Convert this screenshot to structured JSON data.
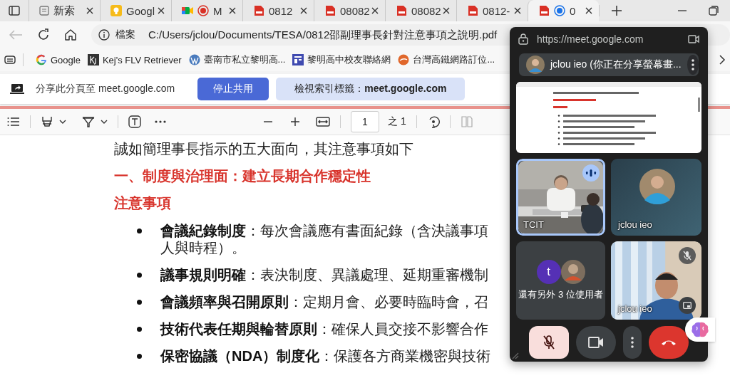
{
  "tabs": [
    {
      "title": "新索",
      "selected": false
    },
    {
      "title": "Googl",
      "selected": false
    },
    {
      "title": "M",
      "selected": false
    },
    {
      "title": "0812",
      "selected": false
    },
    {
      "title": "08082",
      "selected": false
    },
    {
      "title": "08082",
      "selected": false
    },
    {
      "title": "0812-",
      "selected": false
    },
    {
      "title": "0",
      "selected": true
    }
  ],
  "address_bar": {
    "scheme_label": "檔案",
    "url": "C:/Users/jclou/Documents/TESA/0812邵副理事長針對注意事項之說明.pdf",
    "back_disabled": true
  },
  "bookmarks": [
    {
      "label": "Google"
    },
    {
      "label": "Kej's FLV Retriever"
    },
    {
      "label": "臺南市私立黎明高..."
    },
    {
      "label": "黎明高中校友聯絡網"
    },
    {
      "label": "台灣高鐵網路訂位..."
    }
  ],
  "share_bar": {
    "message": "分享此分頁至 meet.google.com",
    "stop_button": "停止共用",
    "view_button": "檢視索引標籤：**meet.google.com**"
  },
  "pdf_toolbar": {
    "page": "1",
    "page_count": "之 1"
  },
  "document": {
    "intro": "誠如簡理事長指示的五大面向，其注意事項如下",
    "heading": "一、制度與治理面：建立長期合作穩定性",
    "subheading": "注意事項",
    "bullets": [
      {
        "text": "**會議紀錄制度**：每次會議應有書面紀錄（含決議事項",
        "continuation": "人與時程）。"
      },
      {
        "text": "**議事規則明確**：表決制度、異議處理、延期重審機制"
      },
      {
        "text": "**會議頻率與召開原則**：定期月會、必要時臨時會，召"
      },
      {
        "text": "**技術代表任期與輪替原則**：確保人員交接不影響合作"
      },
      {
        "text": "**保密協議（NDA）制度化**：保護各方商業機密與技術"
      }
    ]
  },
  "meet": {
    "url": "https://meet.google.com",
    "presenter": "jclou ieo (你正在分享螢幕畫...",
    "tiles": [
      {
        "kind": "video",
        "name": "TCIT",
        "speaking": true,
        "mic_muted": false,
        "expand_button": false
      },
      {
        "kind": "avatar",
        "name": "jclou ieo"
      },
      {
        "kind": "group",
        "avatar_letter": "t",
        "label": "還有另外 3 位使用者"
      },
      {
        "kind": "video",
        "name": "jclou ieo",
        "speaking": false,
        "mic_muted": true,
        "expand_button": true
      }
    ],
    "controls": [
      {
        "kind": "mic",
        "muted": true
      },
      {
        "kind": "camera",
        "muted": false
      },
      {
        "kind": "more"
      },
      {
        "kind": "leave"
      }
    ]
  }
}
